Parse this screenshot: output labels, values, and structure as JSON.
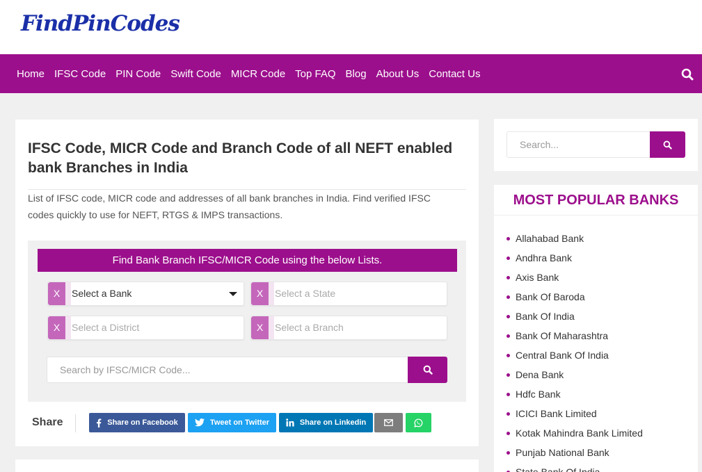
{
  "site": {
    "logo": "FindPinCodes"
  },
  "nav": {
    "items": [
      "Home",
      "IFSC Code",
      "PIN Code",
      "Swift Code",
      "MICR Code",
      "Top FAQ",
      "Blog",
      "About Us",
      "Contact Us"
    ],
    "search_icon": "search-icon"
  },
  "main": {
    "title": "IFSC Code, MICR Code and Branch Code of all NEFT enabled bank Branches in India",
    "intro": "List of IFSC code, MICR code and addresses of all bank branches in India. Find verified IFSC codes quickly to use for NEFT, RTGS & IMPS transactions.",
    "finder": {
      "heading": "Find Bank Branch IFSC/MICR Code using the below Lists.",
      "clear_label": "X",
      "bank": "Select a Bank",
      "state": "Select a State",
      "district": "Select a District",
      "branch": "Select a Branch",
      "search_placeholder": "Search by IFSC/MICR Code..."
    },
    "share": {
      "label": "Share",
      "facebook": "Share on Facebook",
      "twitter": "Tweet on Twitter",
      "linkedin": "Share on Linkedin"
    }
  },
  "sidebar": {
    "search_placeholder": "Search...",
    "popular_title": "MOST POPULAR BANKS",
    "banks": [
      "Allahabad Bank",
      "Andhra Bank",
      "Axis Bank",
      "Bank Of Baroda",
      "Bank Of India",
      "Bank Of Maharashtra",
      "Central Bank Of India",
      "Dena Bank",
      "Hdfc Bank",
      "ICICI Bank Limited",
      "Kotak Mahindra Bank Limited",
      "Punjab National Bank",
      "State Bank Of India"
    ]
  },
  "colors": {
    "brand": "#9c0f8c",
    "logo": "#1b2fa8",
    "facebook": "#3b5998",
    "twitter": "#1da1f2",
    "linkedin": "#0077b5",
    "email": "#7d7d7d",
    "whatsapp": "#25d366"
  }
}
